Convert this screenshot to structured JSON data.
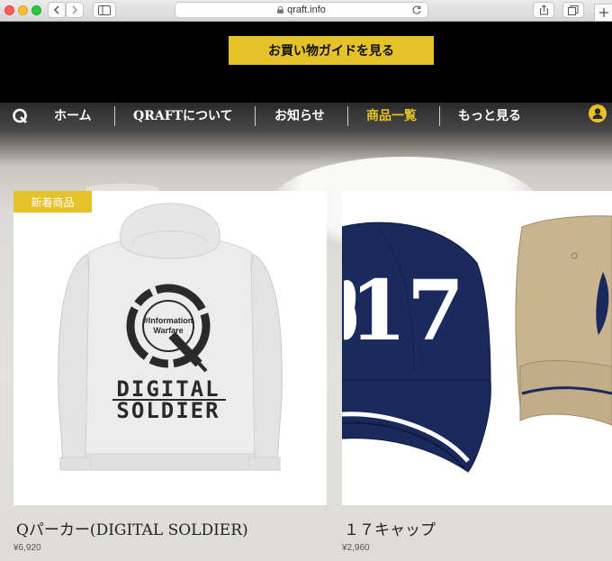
{
  "browser": {
    "url": "qraft.info"
  },
  "header": {
    "guide_button": "お買い物ガイドを見る"
  },
  "nav": {
    "logo_icon": "q-logo-icon",
    "items": [
      {
        "label": "ホーム",
        "active": false
      },
      {
        "label": "QRAFTについて",
        "active": false
      },
      {
        "label": "お知らせ",
        "active": false
      },
      {
        "label": "商品一覧",
        "active": true
      },
      {
        "label": "もっと見る",
        "active": false
      }
    ],
    "user_icon": "user-icon"
  },
  "products": [
    {
      "badge": "新着商品",
      "name": "Qパーカー(DIGITAL SOLDIER)",
      "price": "¥6,920",
      "print_text": [
        "#Information",
        "Warfare"
      ],
      "print_logo_text": [
        "DIGITAL",
        "SOLDIER"
      ]
    },
    {
      "name": "１７キャップ",
      "price": "¥2,960",
      "print_text": "17"
    }
  ],
  "colors": {
    "accent": "#e5c12a",
    "header_bg": "#000000",
    "navy": "#1b2a5c",
    "khaki": "#c9b48f"
  }
}
